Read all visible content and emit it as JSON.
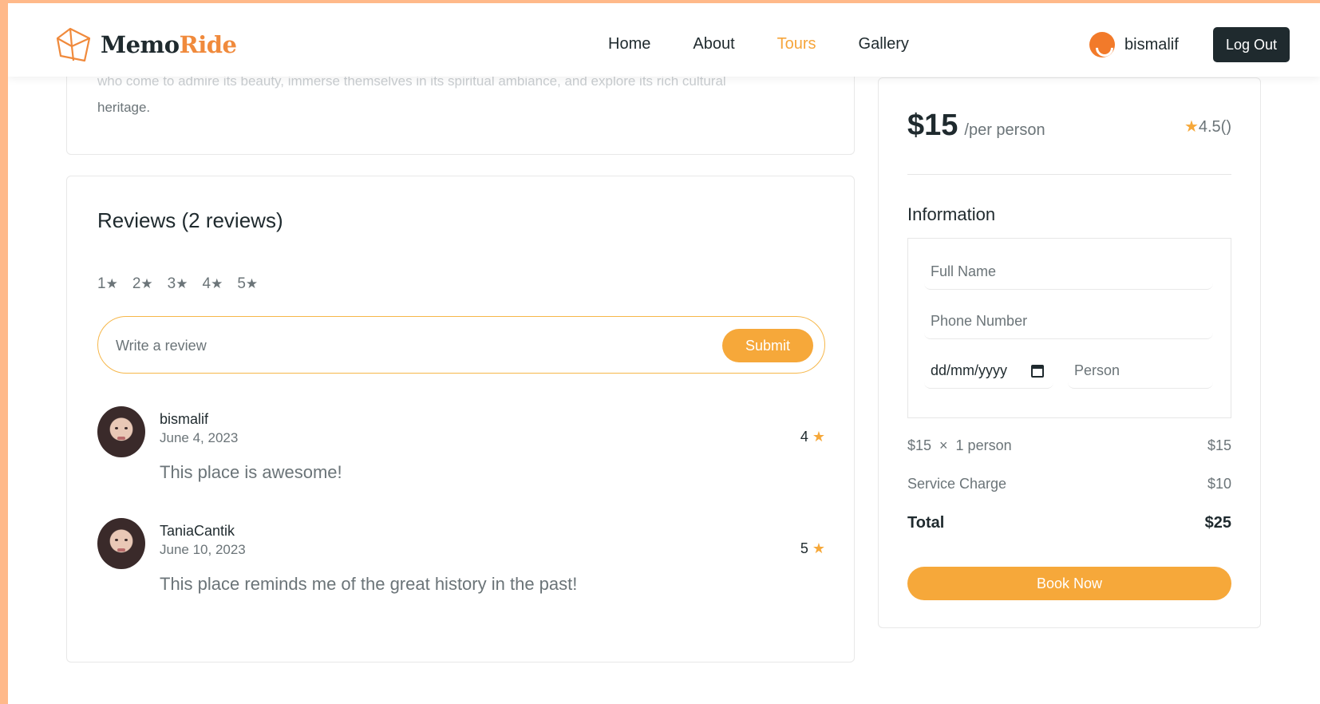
{
  "header": {
    "brand_part1": "Memo",
    "brand_part2": "Ride",
    "nav": [
      "Home",
      "About",
      "Tours",
      "Gallery"
    ],
    "active_nav": "Tours",
    "username": "bismalif",
    "logout_label": "Log Out"
  },
  "description": {
    "cut_line": "who come to admire its beauty, immerse themselves in its spiritual ambiance, and explore its rich cultural",
    "last_line": "heritage."
  },
  "reviews": {
    "title": "Reviews (2 reviews)",
    "star_filters": [
      "1",
      "2",
      "3",
      "4",
      "5"
    ],
    "input_placeholder": "Write a review",
    "submit_label": "Submit",
    "items": [
      {
        "name": "bismalif",
        "date": "June 4, 2023",
        "rating": "4",
        "text": "This place is awesome!"
      },
      {
        "name": "TaniaCantik",
        "date": "June 10, 2023",
        "rating": "5",
        "text": "This place reminds me of the great history in the past!"
      }
    ]
  },
  "booking": {
    "price": "$15",
    "per": "/per person",
    "rating": "4.5()",
    "info_title": "Information",
    "full_name_placeholder": "Full Name",
    "phone_placeholder": "Phone Number",
    "date_placeholder": "dd/mm/yyyy",
    "person_placeholder": "Person",
    "line1_label": "$15  ×  1 person",
    "line1_value": "$15",
    "service_label": "Service Charge",
    "service_value": "$10",
    "total_label": "Total",
    "total_value": "$25",
    "book_label": "Book Now"
  },
  "colors": {
    "accent": "#f6a83a",
    "brand_orange": "#f08a3c",
    "dark": "#1f2a2e",
    "muted": "#6b7478"
  }
}
